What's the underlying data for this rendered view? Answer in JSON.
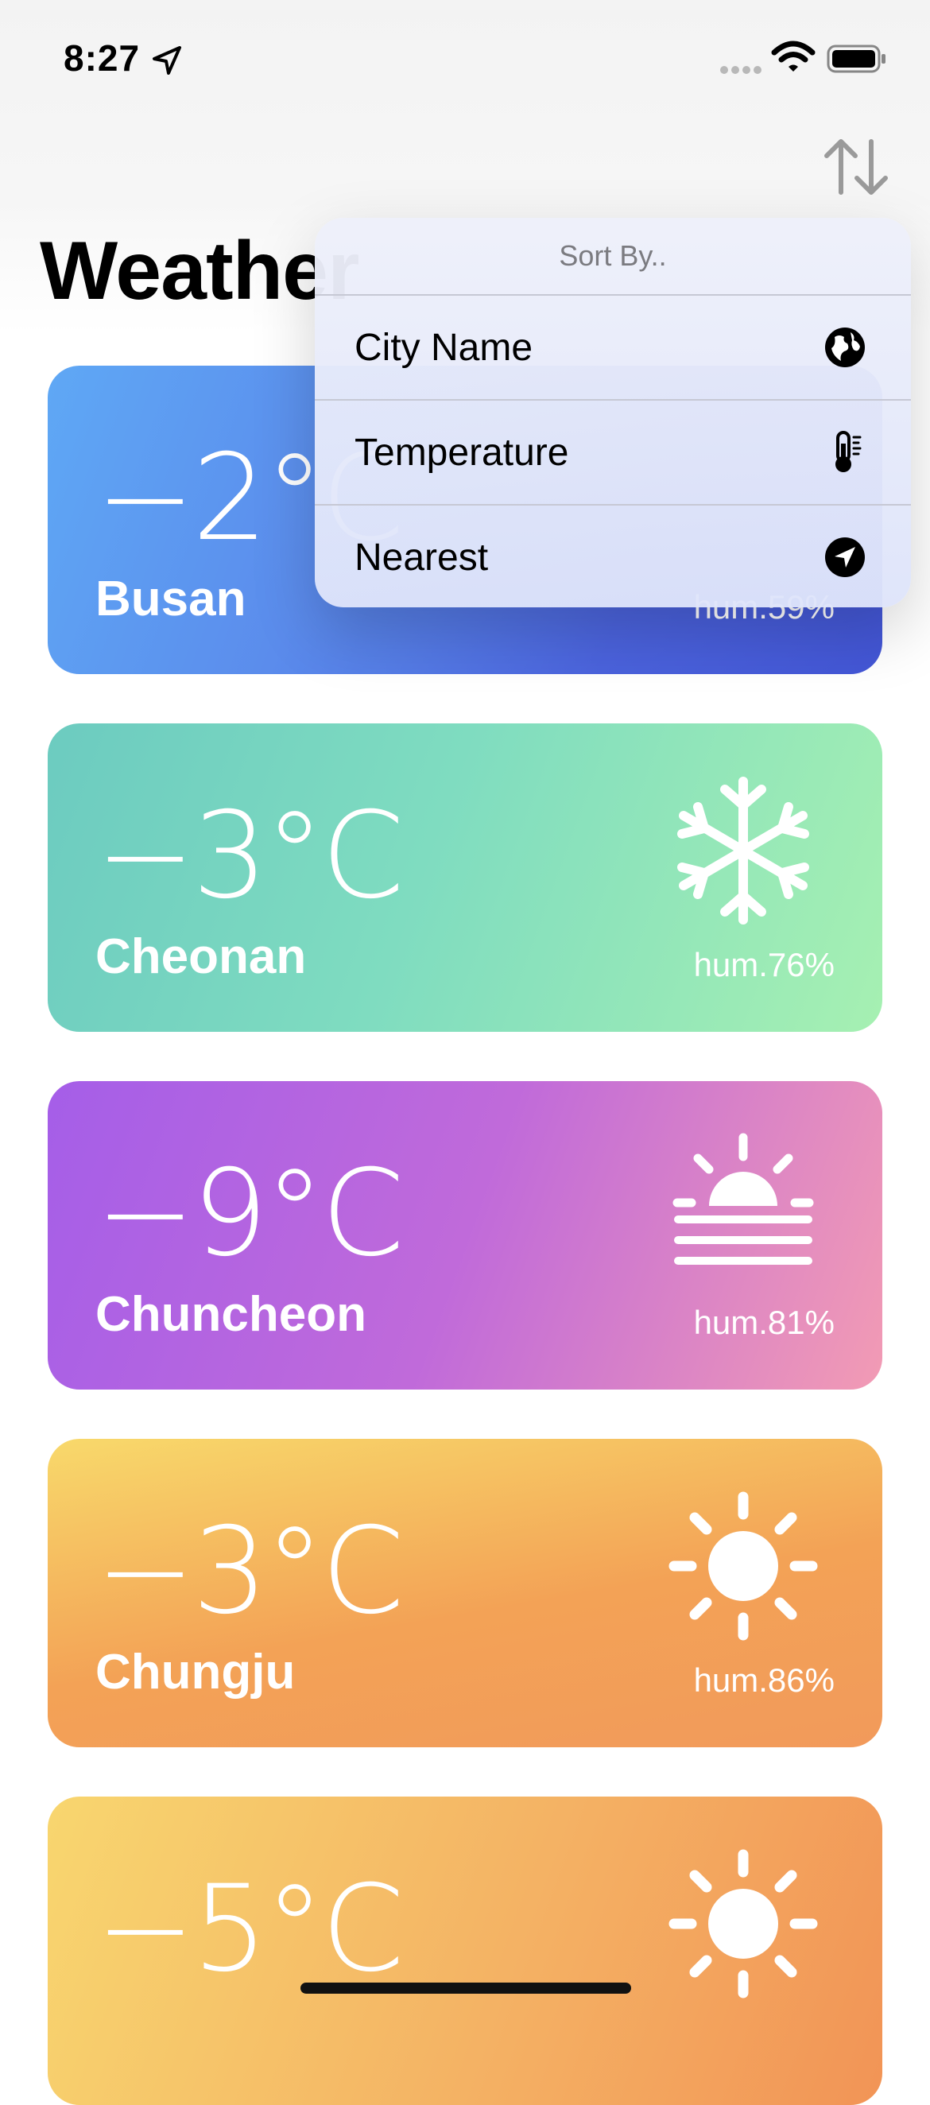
{
  "status_bar": {
    "time": "8:27"
  },
  "header": {
    "title": "Weather"
  },
  "sort_menu": {
    "title": "Sort By..",
    "items": [
      {
        "label": "City Name",
        "icon": "globe-icon"
      },
      {
        "label": "Temperature",
        "icon": "thermometer-icon"
      },
      {
        "label": "Nearest",
        "icon": "location-arrow-icon"
      }
    ]
  },
  "cards": [
    {
      "temp": "−2°C",
      "city": "Busan",
      "humidity": "hum.59%",
      "icon": "partly-hidden"
    },
    {
      "temp": "−3°C",
      "city": "Cheonan",
      "humidity": "hum.76%",
      "icon": "snowflake-icon"
    },
    {
      "temp": "−9°C",
      "city": "Chuncheon",
      "humidity": "hum.81%",
      "icon": "sunrise-fog-icon"
    },
    {
      "temp": "−3°C",
      "city": "Chungju",
      "humidity": "hum.86%",
      "icon": "sun-icon"
    },
    {
      "temp": "−5°C",
      "city": "",
      "humidity": "",
      "icon": "sun-icon"
    }
  ],
  "colors": {
    "card_busan": "#4b63dd",
    "card_cheonan": "#7fdcc0",
    "card_chuncheon": "#c06ada",
    "card_chungju": "#f3a256"
  }
}
